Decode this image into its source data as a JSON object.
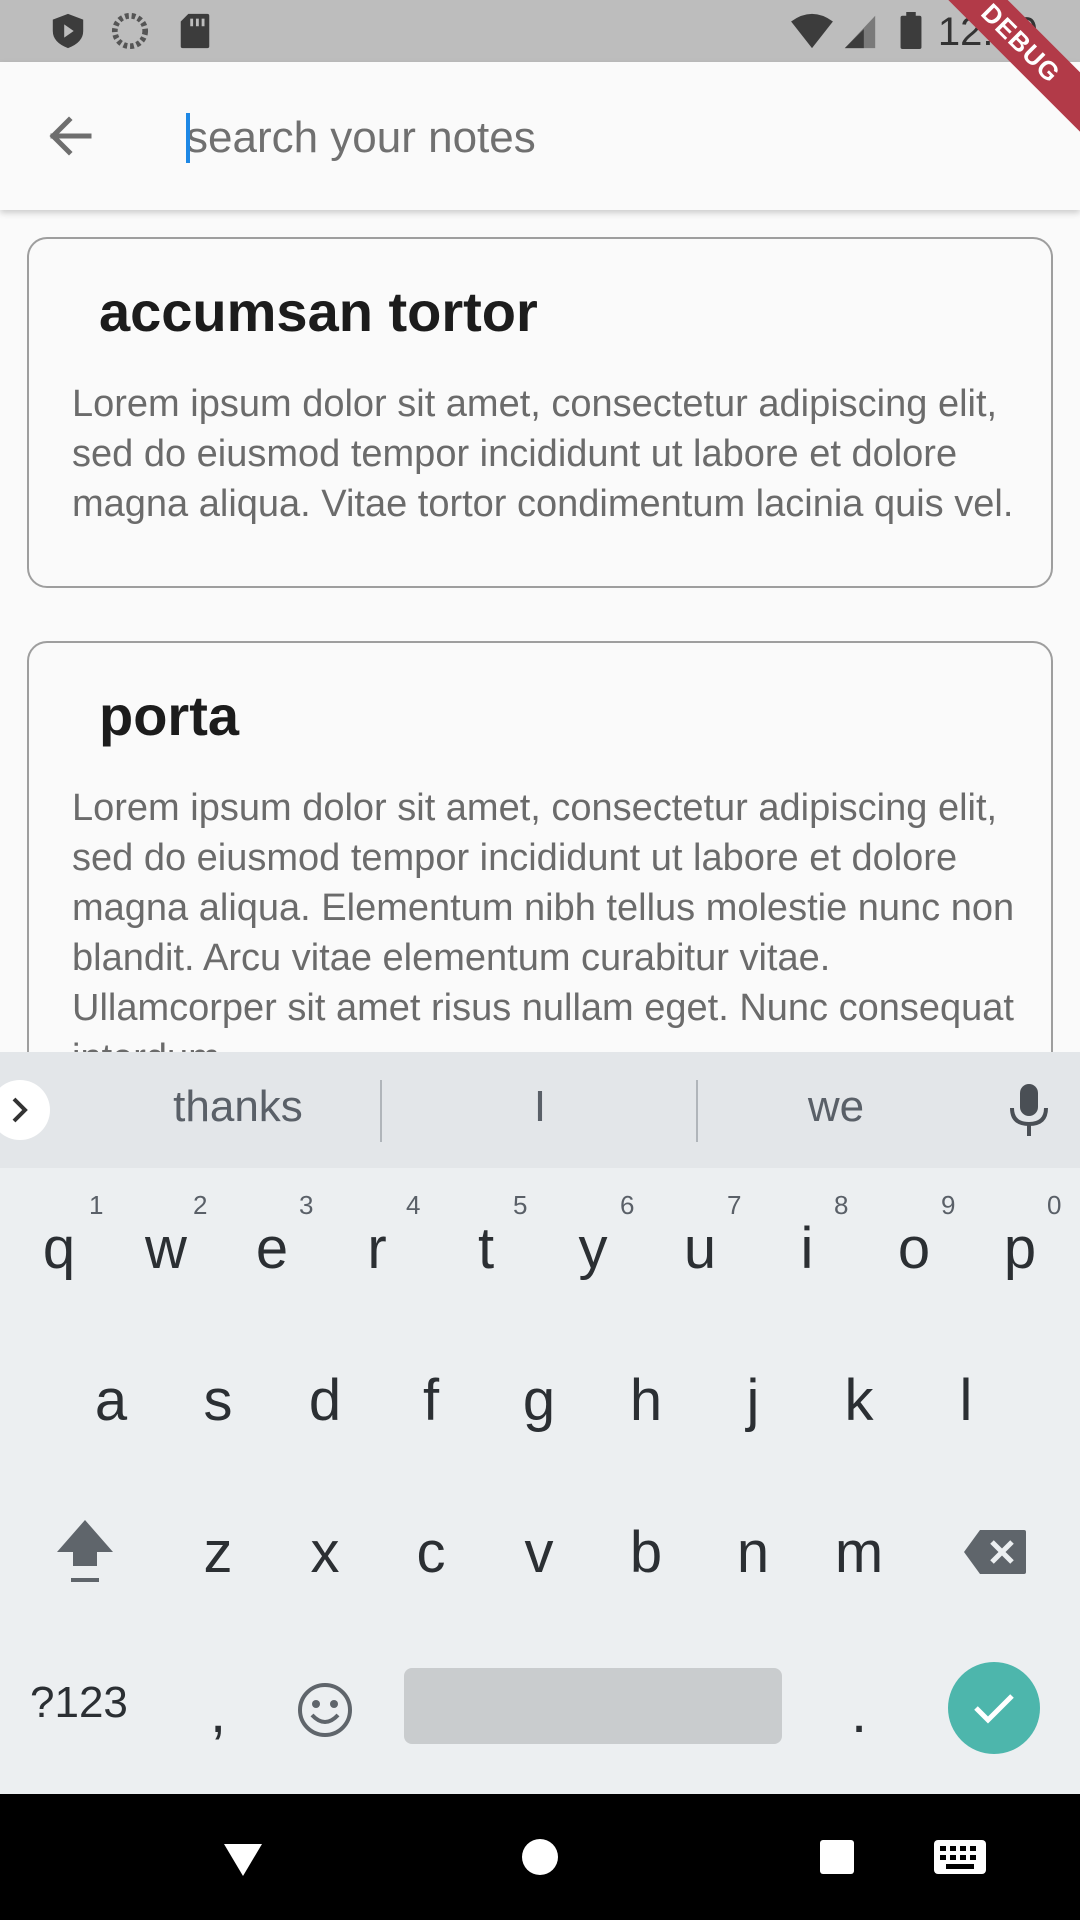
{
  "status_bar": {
    "time": "12:19",
    "icons": [
      "shield-play-icon",
      "sync-icon",
      "sd-card-icon",
      "wifi-icon",
      "signal-icon",
      "battery-icon"
    ]
  },
  "debug_banner": "DEBUG",
  "app_bar": {
    "back_icon": "arrow-back-icon",
    "search_placeholder": "search your notes",
    "search_value": ""
  },
  "notes": [
    {
      "title": "accumsan tortor",
      "body": "Lorem ipsum dolor sit amet, consectetur adipiscing elit, sed do eiusmod tempor incididunt ut labore et dolore magna aliqua. Vitae tortor condimentum lacinia quis vel."
    },
    {
      "title": "porta",
      "body": "Lorem ipsum dolor sit amet, consectetur adipiscing elit, sed do eiusmod tempor incididunt ut labore et dolore magna aliqua. Elementum nibh tellus molestie nunc non blandit. Arcu vitae elementum curabitur vitae. Ullamcorper sit amet risus nullam eget. Nunc consequat interdum"
    }
  ],
  "keyboard": {
    "suggestions": [
      "thanks",
      "I",
      "we"
    ],
    "row1": [
      "q",
      "w",
      "e",
      "r",
      "t",
      "y",
      "u",
      "i",
      "o",
      "p"
    ],
    "row1_hints": [
      "1",
      "2",
      "3",
      "4",
      "5",
      "6",
      "7",
      "8",
      "9",
      "0"
    ],
    "row2": [
      "a",
      "s",
      "d",
      "f",
      "g",
      "h",
      "j",
      "k",
      "l"
    ],
    "row3": [
      "z",
      "x",
      "c",
      "v",
      "b",
      "n",
      "m"
    ],
    "symbols_label": "?123",
    "comma": ",",
    "period": ".",
    "accent_color": "#4db6ac"
  },
  "nav_bar": {
    "icons": [
      "back-triangle-icon",
      "home-circle-icon",
      "recents-square-icon",
      "keyboard-switch-icon"
    ]
  }
}
